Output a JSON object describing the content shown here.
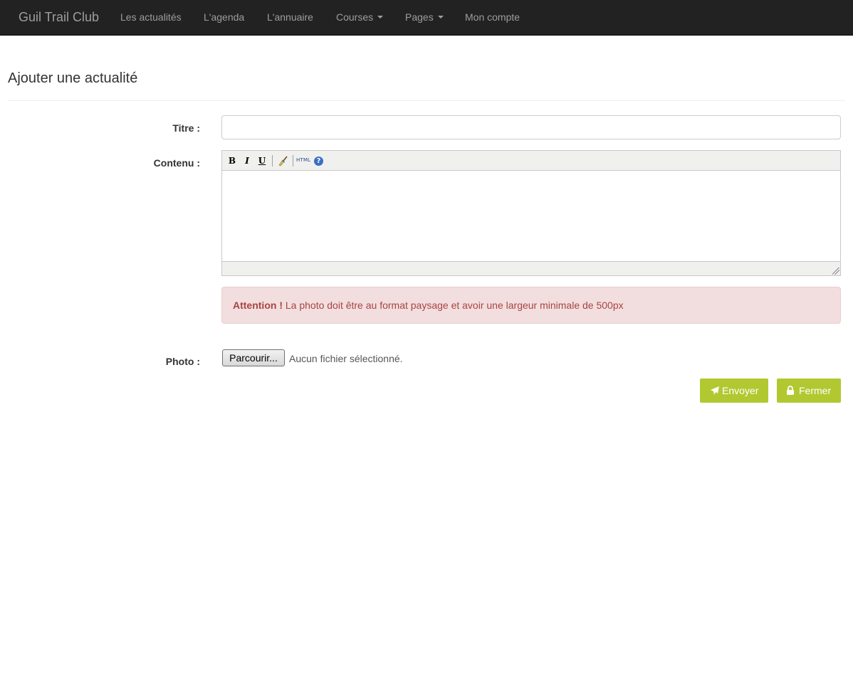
{
  "navbar": {
    "brand": "Guil Trail Club",
    "items": [
      {
        "label": "Les actualités"
      },
      {
        "label": "L'agenda"
      },
      {
        "label": "L'annuaire"
      },
      {
        "label": "Courses"
      },
      {
        "label": "Pages"
      },
      {
        "label": "Mon compte"
      }
    ]
  },
  "page": {
    "title": "Ajouter une actualité"
  },
  "form": {
    "title_label": "Titre :",
    "title_value": "",
    "content_label": "Contenu :",
    "editor_toolbar": {
      "bold": "B",
      "italic": "I",
      "underline": "U",
      "clean_icon": "broom-icon",
      "html": "HTML",
      "help": "?"
    },
    "alert": {
      "strong": "Attention !",
      "message": "La photo doit être au format paysage et avoir une largeur minimale de 500px",
      "color": "#a94442",
      "background": "#f2dede"
    },
    "photo_label": "Photo :",
    "file_button": "Parcourir...",
    "file_status": "Aucun fichier sélectionné."
  },
  "actions": {
    "send_label": "Envoyer",
    "send_icon": "paper-plane-icon",
    "close_label": "Fermer",
    "close_icon": "lock-icon",
    "color": "#b2c831"
  }
}
